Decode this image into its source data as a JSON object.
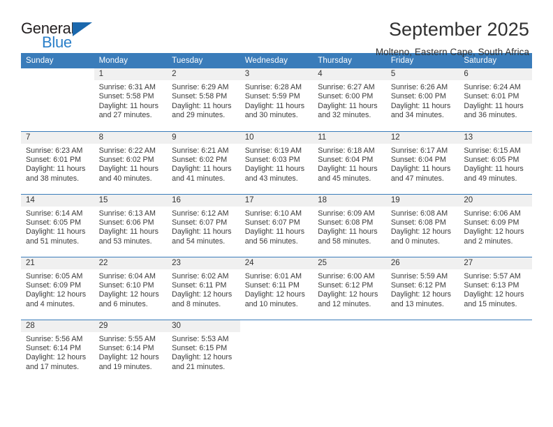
{
  "brand": {
    "name_part1": "General",
    "name_part2": "Blue",
    "triangle_icon": "blue-triangle-icon",
    "color_dark": "#231f20",
    "color_blue": "#2a7fc9"
  },
  "header": {
    "title": "September 2025",
    "subtitle": "Molteno, Eastern Cape, South Africa"
  },
  "theme": {
    "header_bg": "#3a7cba",
    "header_text": "#ffffff",
    "daynum_band_bg": "#f0f0f0",
    "row_divider": "#3a7cba",
    "body_text": "#3a3a3a"
  },
  "weekday_headers": [
    "Sunday",
    "Monday",
    "Tuesday",
    "Wednesday",
    "Thursday",
    "Friday",
    "Saturday"
  ],
  "labels": {
    "sunrise_prefix": "Sunrise:",
    "sunset_prefix": "Sunset:",
    "daylight_prefix": "Daylight:"
  },
  "weeks": [
    [
      {
        "day": "",
        "empty": true,
        "sunrise": "",
        "sunset": "",
        "daylight_line1": "",
        "daylight_line2": ""
      },
      {
        "day": "1",
        "empty": false,
        "sunrise": "Sunrise: 6:31 AM",
        "sunset": "Sunset: 5:58 PM",
        "daylight_line1": "Daylight: 11 hours",
        "daylight_line2": "and 27 minutes."
      },
      {
        "day": "2",
        "empty": false,
        "sunrise": "Sunrise: 6:29 AM",
        "sunset": "Sunset: 5:58 PM",
        "daylight_line1": "Daylight: 11 hours",
        "daylight_line2": "and 29 minutes."
      },
      {
        "day": "3",
        "empty": false,
        "sunrise": "Sunrise: 6:28 AM",
        "sunset": "Sunset: 5:59 PM",
        "daylight_line1": "Daylight: 11 hours",
        "daylight_line2": "and 30 minutes."
      },
      {
        "day": "4",
        "empty": false,
        "sunrise": "Sunrise: 6:27 AM",
        "sunset": "Sunset: 6:00 PM",
        "daylight_line1": "Daylight: 11 hours",
        "daylight_line2": "and 32 minutes."
      },
      {
        "day": "5",
        "empty": false,
        "sunrise": "Sunrise: 6:26 AM",
        "sunset": "Sunset: 6:00 PM",
        "daylight_line1": "Daylight: 11 hours",
        "daylight_line2": "and 34 minutes."
      },
      {
        "day": "6",
        "empty": false,
        "sunrise": "Sunrise: 6:24 AM",
        "sunset": "Sunset: 6:01 PM",
        "daylight_line1": "Daylight: 11 hours",
        "daylight_line2": "and 36 minutes."
      }
    ],
    [
      {
        "day": "7",
        "empty": false,
        "sunrise": "Sunrise: 6:23 AM",
        "sunset": "Sunset: 6:01 PM",
        "daylight_line1": "Daylight: 11 hours",
        "daylight_line2": "and 38 minutes."
      },
      {
        "day": "8",
        "empty": false,
        "sunrise": "Sunrise: 6:22 AM",
        "sunset": "Sunset: 6:02 PM",
        "daylight_line1": "Daylight: 11 hours",
        "daylight_line2": "and 40 minutes."
      },
      {
        "day": "9",
        "empty": false,
        "sunrise": "Sunrise: 6:21 AM",
        "sunset": "Sunset: 6:02 PM",
        "daylight_line1": "Daylight: 11 hours",
        "daylight_line2": "and 41 minutes."
      },
      {
        "day": "10",
        "empty": false,
        "sunrise": "Sunrise: 6:19 AM",
        "sunset": "Sunset: 6:03 PM",
        "daylight_line1": "Daylight: 11 hours",
        "daylight_line2": "and 43 minutes."
      },
      {
        "day": "11",
        "empty": false,
        "sunrise": "Sunrise: 6:18 AM",
        "sunset": "Sunset: 6:04 PM",
        "daylight_line1": "Daylight: 11 hours",
        "daylight_line2": "and 45 minutes."
      },
      {
        "day": "12",
        "empty": false,
        "sunrise": "Sunrise: 6:17 AM",
        "sunset": "Sunset: 6:04 PM",
        "daylight_line1": "Daylight: 11 hours",
        "daylight_line2": "and 47 minutes."
      },
      {
        "day": "13",
        "empty": false,
        "sunrise": "Sunrise: 6:15 AM",
        "sunset": "Sunset: 6:05 PM",
        "daylight_line1": "Daylight: 11 hours",
        "daylight_line2": "and 49 minutes."
      }
    ],
    [
      {
        "day": "14",
        "empty": false,
        "sunrise": "Sunrise: 6:14 AM",
        "sunset": "Sunset: 6:05 PM",
        "daylight_line1": "Daylight: 11 hours",
        "daylight_line2": "and 51 minutes."
      },
      {
        "day": "15",
        "empty": false,
        "sunrise": "Sunrise: 6:13 AM",
        "sunset": "Sunset: 6:06 PM",
        "daylight_line1": "Daylight: 11 hours",
        "daylight_line2": "and 53 minutes."
      },
      {
        "day": "16",
        "empty": false,
        "sunrise": "Sunrise: 6:12 AM",
        "sunset": "Sunset: 6:07 PM",
        "daylight_line1": "Daylight: 11 hours",
        "daylight_line2": "and 54 minutes."
      },
      {
        "day": "17",
        "empty": false,
        "sunrise": "Sunrise: 6:10 AM",
        "sunset": "Sunset: 6:07 PM",
        "daylight_line1": "Daylight: 11 hours",
        "daylight_line2": "and 56 minutes."
      },
      {
        "day": "18",
        "empty": false,
        "sunrise": "Sunrise: 6:09 AM",
        "sunset": "Sunset: 6:08 PM",
        "daylight_line1": "Daylight: 11 hours",
        "daylight_line2": "and 58 minutes."
      },
      {
        "day": "19",
        "empty": false,
        "sunrise": "Sunrise: 6:08 AM",
        "sunset": "Sunset: 6:08 PM",
        "daylight_line1": "Daylight: 12 hours",
        "daylight_line2": "and 0 minutes."
      },
      {
        "day": "20",
        "empty": false,
        "sunrise": "Sunrise: 6:06 AM",
        "sunset": "Sunset: 6:09 PM",
        "daylight_line1": "Daylight: 12 hours",
        "daylight_line2": "and 2 minutes."
      }
    ],
    [
      {
        "day": "21",
        "empty": false,
        "sunrise": "Sunrise: 6:05 AM",
        "sunset": "Sunset: 6:09 PM",
        "daylight_line1": "Daylight: 12 hours",
        "daylight_line2": "and 4 minutes."
      },
      {
        "day": "22",
        "empty": false,
        "sunrise": "Sunrise: 6:04 AM",
        "sunset": "Sunset: 6:10 PM",
        "daylight_line1": "Daylight: 12 hours",
        "daylight_line2": "and 6 minutes."
      },
      {
        "day": "23",
        "empty": false,
        "sunrise": "Sunrise: 6:02 AM",
        "sunset": "Sunset: 6:11 PM",
        "daylight_line1": "Daylight: 12 hours",
        "daylight_line2": "and 8 minutes."
      },
      {
        "day": "24",
        "empty": false,
        "sunrise": "Sunrise: 6:01 AM",
        "sunset": "Sunset: 6:11 PM",
        "daylight_line1": "Daylight: 12 hours",
        "daylight_line2": "and 10 minutes."
      },
      {
        "day": "25",
        "empty": false,
        "sunrise": "Sunrise: 6:00 AM",
        "sunset": "Sunset: 6:12 PM",
        "daylight_line1": "Daylight: 12 hours",
        "daylight_line2": "and 12 minutes."
      },
      {
        "day": "26",
        "empty": false,
        "sunrise": "Sunrise: 5:59 AM",
        "sunset": "Sunset: 6:12 PM",
        "daylight_line1": "Daylight: 12 hours",
        "daylight_line2": "and 13 minutes."
      },
      {
        "day": "27",
        "empty": false,
        "sunrise": "Sunrise: 5:57 AM",
        "sunset": "Sunset: 6:13 PM",
        "daylight_line1": "Daylight: 12 hours",
        "daylight_line2": "and 15 minutes."
      }
    ],
    [
      {
        "day": "28",
        "empty": false,
        "sunrise": "Sunrise: 5:56 AM",
        "sunset": "Sunset: 6:14 PM",
        "daylight_line1": "Daylight: 12 hours",
        "daylight_line2": "and 17 minutes."
      },
      {
        "day": "29",
        "empty": false,
        "sunrise": "Sunrise: 5:55 AM",
        "sunset": "Sunset: 6:14 PM",
        "daylight_line1": "Daylight: 12 hours",
        "daylight_line2": "and 19 minutes."
      },
      {
        "day": "30",
        "empty": false,
        "sunrise": "Sunrise: 5:53 AM",
        "sunset": "Sunset: 6:15 PM",
        "daylight_line1": "Daylight: 12 hours",
        "daylight_line2": "and 21 minutes."
      },
      {
        "day": "",
        "empty": true,
        "sunrise": "",
        "sunset": "",
        "daylight_line1": "",
        "daylight_line2": ""
      },
      {
        "day": "",
        "empty": true,
        "sunrise": "",
        "sunset": "",
        "daylight_line1": "",
        "daylight_line2": ""
      },
      {
        "day": "",
        "empty": true,
        "sunrise": "",
        "sunset": "",
        "daylight_line1": "",
        "daylight_line2": ""
      },
      {
        "day": "",
        "empty": true,
        "sunrise": "",
        "sunset": "",
        "daylight_line1": "",
        "daylight_line2": ""
      }
    ]
  ]
}
